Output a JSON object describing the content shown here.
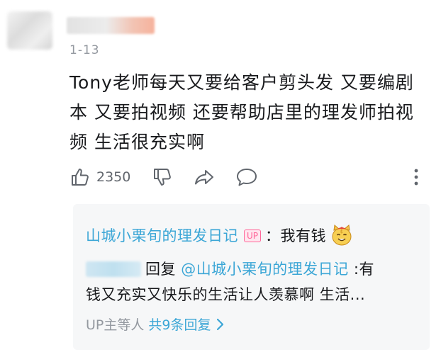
{
  "comment": {
    "date": "1-13",
    "text_lines": [
      "Tony老师每天又要给客户剪头发 又要编剧",
      "本 又要拍视频 还要帮助店里的理发师拍视",
      "频 生活很充实啊"
    ],
    "likes": "2350"
  },
  "replies": {
    "first": {
      "author": "山城小栗旬的理发日记",
      "badge": "UP",
      "text": "：我有钱"
    },
    "second": {
      "prefix": "回复 ",
      "mention": "@山城小栗旬的理发日记",
      "line1_text": " :有",
      "line2_text": "钱又充实又快乐的生活让人羡慕啊 生活..."
    },
    "more": {
      "label": "UP主等人",
      "count_label": "共9条回复"
    }
  },
  "colors": {
    "link": "#3ba6d6",
    "up_badge": "#ff6699",
    "muted": "#9499a0"
  }
}
